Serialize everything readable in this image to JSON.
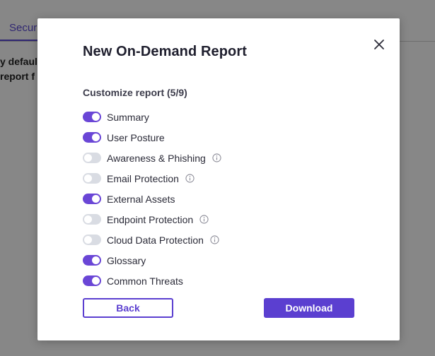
{
  "background": {
    "tab_label": "Secur",
    "text_line_1": "y default",
    "text_line_2": "report f"
  },
  "modal": {
    "title": "New On-Demand Report",
    "section_label": "Customize report (5/9)",
    "options": [
      {
        "label": "Summary",
        "enabled": true,
        "info": false
      },
      {
        "label": "User Posture",
        "enabled": true,
        "info": false
      },
      {
        "label": "Awareness & Phishing",
        "enabled": false,
        "info": true
      },
      {
        "label": "Email Protection",
        "enabled": false,
        "info": true
      },
      {
        "label": "External Assets",
        "enabled": true,
        "info": false
      },
      {
        "label": "Endpoint Protection",
        "enabled": false,
        "info": true
      },
      {
        "label": "Cloud Data Protection",
        "enabled": false,
        "info": true
      },
      {
        "label": "Glossary",
        "enabled": true,
        "info": false
      },
      {
        "label": "Common Threats",
        "enabled": true,
        "info": false
      }
    ],
    "back_label": "Back",
    "download_label": "Download"
  },
  "colors": {
    "accent": "#5b3fd0",
    "toggle_on": "#6a46d6",
    "toggle_off": "#d9dce3"
  },
  "icons": {
    "close": "close-icon",
    "info": "info-icon"
  }
}
